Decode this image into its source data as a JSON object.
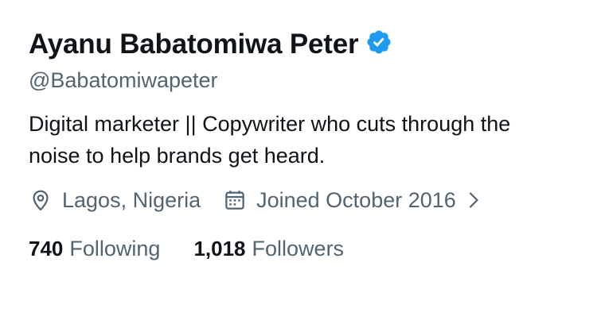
{
  "profile": {
    "display_name": "Ayanu Babatomiwa Peter",
    "handle": "@Babatomiwapeter",
    "bio": "Digital marketer || Copywriter who cuts through the noise to help brands get heard.",
    "location": "Lagos, Nigeria",
    "joined": "Joined October 2016",
    "verified": true,
    "verified_color": "#1d9bf0"
  },
  "stats": {
    "following_count": "740",
    "following_label": "Following",
    "followers_count": "1,018",
    "followers_label": "Followers"
  },
  "icons": {
    "location": "map-pin-icon",
    "joined": "calendar-icon",
    "expand": "chevron-right-icon",
    "verified": "verified-badge-icon"
  },
  "colors": {
    "primary_text": "#0f1419",
    "secondary_text": "#536471",
    "accent": "#1d9bf0"
  }
}
